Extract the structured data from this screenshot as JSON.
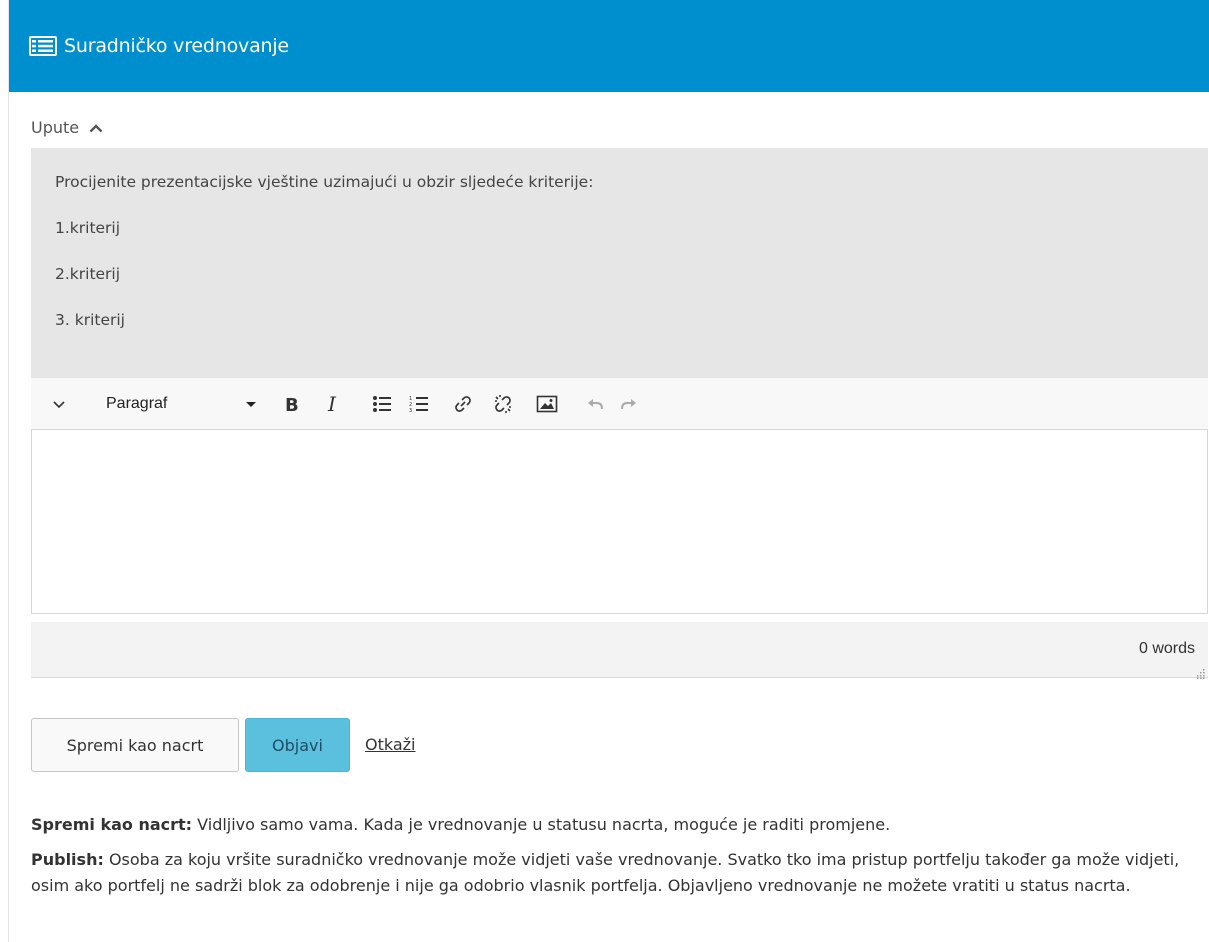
{
  "header": {
    "icon": "list-form-icon",
    "title": "Suradničko vrednovanje",
    "color": "#008fce"
  },
  "instructions": {
    "toggle_label": "Upute",
    "toggle_icon": "chevron-up-icon",
    "lines": [
      "Procijenite prezentacijske vještine uzimajući u obzir sljedeće kriterije:",
      "1.kriterij",
      "2.kriterij",
      "3. kriterij"
    ]
  },
  "toolbar": {
    "collapse_icon": "chevron-down-icon",
    "format_value": "Paragraf",
    "buttons": [
      "bold-icon",
      "italic-icon",
      "bullet-list-icon",
      "numbered-list-icon",
      "link-icon",
      "unlink-icon",
      "image-icon",
      "undo-icon",
      "redo-icon"
    ]
  },
  "editor": {
    "content": "",
    "word_count": "0 words"
  },
  "actions": {
    "save_draft": "Spremi kao nacrt",
    "publish": "Objavi",
    "cancel": "Otkaži",
    "publish_color": "#5bc0de"
  },
  "help": {
    "draft_label": "Spremi kao nacrt:",
    "draft_text": " Vidljivo samo vama. Kada je vrednovanje u statusu nacrta, moguće je raditi promjene.",
    "publish_label": "Publish:",
    "publish_text": " Osoba za koju vršite suradničko vrednovanje može vidjeti vaše vrednovanje. Svatko tko ima pristup portfelju također ga može vidjeti, osim ako portfelj ne sadrži blok za odobrenje i nije ga odobrio vlasnik portfelja. Objavljeno vrednovanje ne možete vratiti u status nacrta."
  }
}
